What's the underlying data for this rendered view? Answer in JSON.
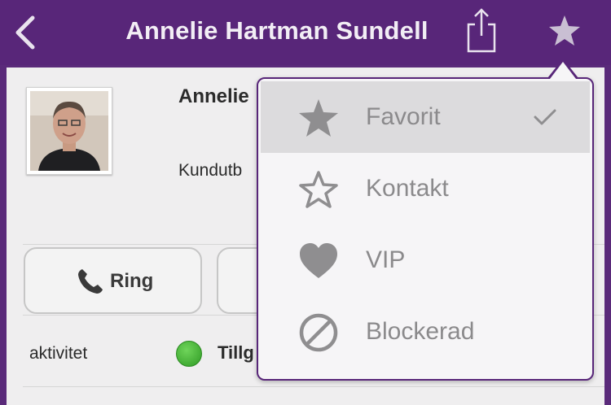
{
  "header": {
    "title": "Annelie Hartman Sundell"
  },
  "contact": {
    "name_partial": "Annelie",
    "role_partial": "Kundutb"
  },
  "actions": {
    "call_label": "Ring"
  },
  "status": {
    "activity_label": "aktivitet",
    "status_partial": "Tillg",
    "status_color": "#3aa32b"
  },
  "menu": {
    "items": [
      {
        "label": "Favorit",
        "icon": "star-filled-icon",
        "selected": true
      },
      {
        "label": "Kontakt",
        "icon": "star-outline-icon",
        "selected": false
      },
      {
        "label": "VIP",
        "icon": "heart-icon",
        "selected": false
      },
      {
        "label": "Blockerad",
        "icon": "blocked-icon",
        "selected": false
      }
    ]
  },
  "colors": {
    "brand": "#582679",
    "menu_text": "#8b8a8c",
    "selected_bg": "#dcdbdd"
  }
}
